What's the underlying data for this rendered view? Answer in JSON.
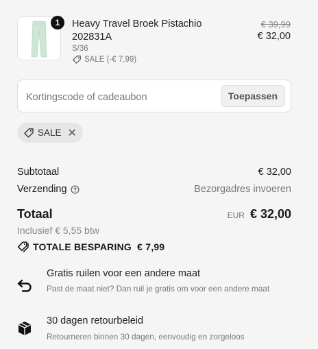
{
  "product": {
    "quantity": "1",
    "name": "Heavy Travel Broek Pistachio 202831A",
    "variant": "S/36",
    "sale_tag": "SALE (-€ 7,99)",
    "old_price": "€ 39,99",
    "new_price": "€ 32,00"
  },
  "discount": {
    "placeholder": "Kortingscode of cadeaubon",
    "apply_label": "Toepassen",
    "applied_code": "SALE"
  },
  "summary": {
    "subtotal_label": "Subtotaal",
    "subtotal_value": "€ 32,00",
    "shipping_label": "Verzending",
    "shipping_value": "Bezorgadres invoeren",
    "total_label": "Totaal",
    "total_currency": "EUR",
    "total_value": "€ 32,00",
    "vat_text": "Inclusief € 5,55 btw",
    "savings_text": "TOTALE BESPARING  € 7,99"
  },
  "perks": [
    {
      "title": "Gratis ruilen voor een andere maat",
      "desc": "Past de maat niet? Dan ruil je gratis om voor een andere maat",
      "icon": "exchange-icon"
    },
    {
      "title": "30 dagen retourbeleid",
      "desc": "Retourneren binnen 30 dagen, eenvoudig en zorgeloos",
      "icon": "box-icon"
    }
  ],
  "colors": {
    "background": "#f5f5f5",
    "text": "#1a1a1a",
    "muted": "#777777",
    "pistachio": "#cfe6d6"
  }
}
